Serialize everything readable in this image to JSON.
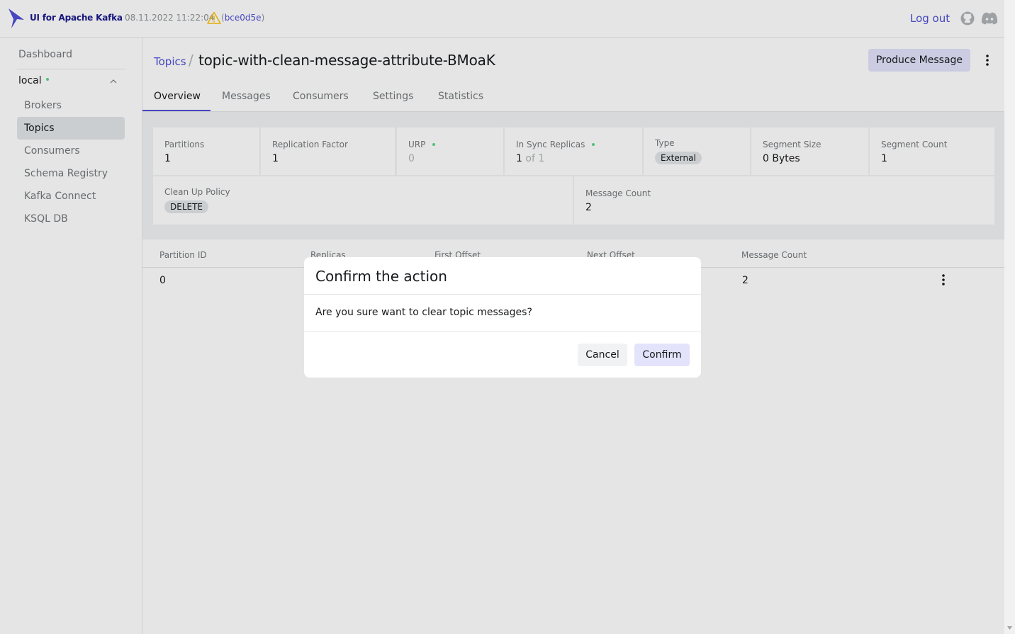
{
  "header": {
    "brand": "UI for Apache Kafka",
    "version_date": "08.11.2022 11:22:04",
    "commit_hash": "bce0d5e",
    "logout_label": "Log out"
  },
  "sidebar": {
    "dashboard_label": "Dashboard",
    "cluster_name": "local",
    "cluster_status_color": "#5cd685",
    "items": [
      {
        "label": "Brokers",
        "active": false
      },
      {
        "label": "Topics",
        "active": true
      },
      {
        "label": "Consumers",
        "active": false
      },
      {
        "label": "Schema Registry",
        "active": false
      },
      {
        "label": "Kafka Connect",
        "active": false
      },
      {
        "label": "KSQL DB",
        "active": false
      }
    ]
  },
  "page": {
    "breadcrumb_link": "Topics",
    "breadcrumb_sep": "/",
    "topic_name": "topic-with-clean-message-attribute-BMoaK",
    "produce_label": "Produce Message"
  },
  "tabs": [
    {
      "label": "Overview",
      "active": true
    },
    {
      "label": "Messages",
      "active": false
    },
    {
      "label": "Consumers",
      "active": false
    },
    {
      "label": "Settings",
      "active": false
    },
    {
      "label": "Statistics",
      "active": false
    }
  ],
  "stats": {
    "partitions": {
      "label": "Partitions",
      "value": "1"
    },
    "replication": {
      "label": "Replication Factor",
      "value": "1"
    },
    "urp": {
      "label": "URP",
      "value": "0"
    },
    "insync": {
      "label": "In Sync Replicas",
      "value": "1",
      "of": "of 1"
    },
    "type": {
      "label": "Type",
      "value": "External"
    },
    "segment_size": {
      "label": "Segment Size",
      "value": "0 Bytes"
    },
    "segment_count": {
      "label": "Segment Count",
      "value": "1"
    },
    "cleanup": {
      "label": "Clean Up Policy",
      "value": "DELETE"
    },
    "message_count": {
      "label": "Message Count",
      "value": "2"
    }
  },
  "table": {
    "columns": [
      "Partition ID",
      "Replicas",
      "First Offset",
      "Next Offset",
      "Message Count"
    ],
    "rows": [
      {
        "partition": "0",
        "message_count": "2"
      }
    ]
  },
  "modal": {
    "title": "Confirm the action",
    "body": "Are you sure want to clear topic messages?",
    "cancel_label": "Cancel",
    "confirm_label": "Confirm"
  },
  "colors": {
    "accent": "#4e4ed6",
    "brand": "#1a1a8c",
    "status_ok": "#5cd685",
    "warning": "#ffc107"
  }
}
